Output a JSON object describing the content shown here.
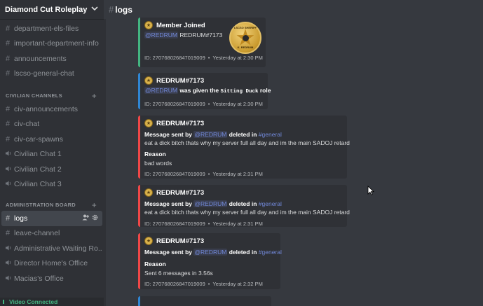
{
  "server": {
    "name": "Diamond Cut Roleplay"
  },
  "channels_top": [
    {
      "label": "department-els-files"
    },
    {
      "label": "important-department-info"
    },
    {
      "label": "announcements"
    },
    {
      "label": "lscso-general-chat"
    }
  ],
  "categories": {
    "civilian": "CIVILIAN CHANNELS",
    "admin": "ADMINISTRATION BOARD"
  },
  "civilian_channels": [
    {
      "label": "civ-announcements",
      "type": "text"
    },
    {
      "label": "civ-chat",
      "type": "text"
    },
    {
      "label": "civ-car-spawns",
      "type": "text"
    },
    {
      "label": "Civilian Chat 1",
      "type": "voice"
    },
    {
      "label": "Civilian Chat 2",
      "type": "voice"
    },
    {
      "label": "Civilian Chat 3",
      "type": "voice"
    }
  ],
  "admin_channels": [
    {
      "label": "logs",
      "type": "text",
      "active": true
    },
    {
      "label": "leave-channel",
      "type": "text"
    },
    {
      "label": "Administrative Waiting Ro...",
      "type": "voice"
    },
    {
      "label": "Director Home's Office",
      "type": "voice"
    },
    {
      "label": "Macias's Office",
      "type": "voice"
    }
  ],
  "voice_status": "Video Connected",
  "channel_header": {
    "title": "logs"
  },
  "embeds": [
    {
      "author": "Member Joined",
      "mention": "@REDRUM",
      "text": "REDRUM#7173",
      "id": "ID: 270768026847019009",
      "time": "Yesterday at 2:30 PM",
      "accent": "#43b581",
      "seal_top": "LSCSO SHERIFF",
      "seal_bottom": "K. REDRUM"
    },
    {
      "author": "REDRUM#7173",
      "mention": "@REDRUM",
      "text_pre": "was given the",
      "role": "Sitting Duck",
      "text_post": "role",
      "id": "ID: 270768026847019009",
      "time": "Yesterday at 2:30 PM",
      "accent": "#2f86d4"
    },
    {
      "author": "REDRUM#7173",
      "lead": "Message sent by",
      "mention": "@REDRUM",
      "mid": "deleted in",
      "channel": "#general",
      "content": "eat a dick bitch thats why my server full all day and im the main SADOJ retard",
      "reason_label": "Reason",
      "reason": "bad words",
      "id": "ID: 270768026847019009",
      "time": "Yesterday at 2:31 PM",
      "accent": "#f04747"
    },
    {
      "author": "REDRUM#7173",
      "lead": "Message sent by",
      "mention": "@REDRUM",
      "mid": "deleted in",
      "channel": "#general",
      "content": "eat a dick bitch thats why my server full all day and im the main SADOJ retard",
      "id": "ID: 270768026847019009",
      "time": "Yesterday at 2:31 PM",
      "accent": "#f04747"
    },
    {
      "author": "REDRUM#7173",
      "lead": "Message sent by",
      "mention": "@REDRUM",
      "mid": "deleted in",
      "channel": "#general",
      "reason_label": "Reason",
      "reason": "Sent 6 messages in 3.56s",
      "id": "ID: 270768026847019009",
      "time": "Yesterday at 2:32 PM",
      "accent": "#f04747"
    }
  ],
  "icons": {
    "server_dropdown": "chevron-down-icon",
    "text_channel": "hash-icon",
    "voice_channel": "speaker-icon",
    "add": "plus-icon",
    "invite": "add-user-icon",
    "settings": "gear-icon",
    "embed_author": "sheriff-badge-icon"
  }
}
